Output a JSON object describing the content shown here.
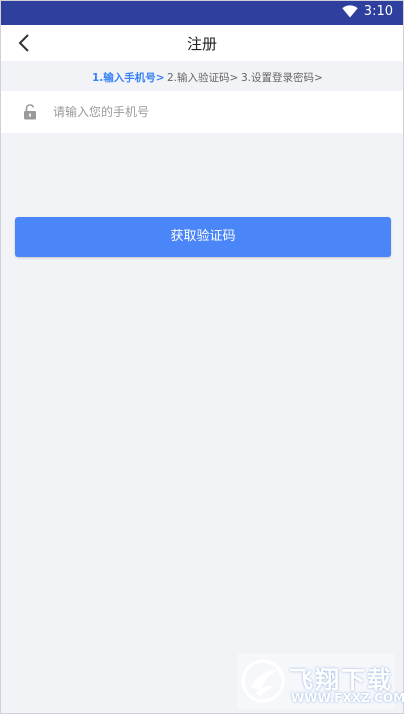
{
  "status_bar": {
    "time": "3:10",
    "icons": [
      "wifi-icon"
    ],
    "background": "#2f3f9e"
  },
  "header": {
    "title": "注册",
    "back_icon": "chevron-left-icon"
  },
  "steps": [
    {
      "label": "1.输入手机号>",
      "active": true
    },
    {
      "label": "2.输入验证码>",
      "active": false
    },
    {
      "label": "3.设置登录密码>",
      "active": false
    }
  ],
  "phone_input": {
    "icon": "lock-icon",
    "placeholder": "请输入您的手机号",
    "value": ""
  },
  "get_code_button": {
    "label": "获取验证码",
    "color": "#4a86f7"
  },
  "watermark": {
    "name": "飞翔下载",
    "url": "WWW.FXXZ.COM"
  },
  "colors": {
    "accent": "#4a86f7",
    "active_step": "#3b82f6",
    "background": "#f2f3f7"
  }
}
